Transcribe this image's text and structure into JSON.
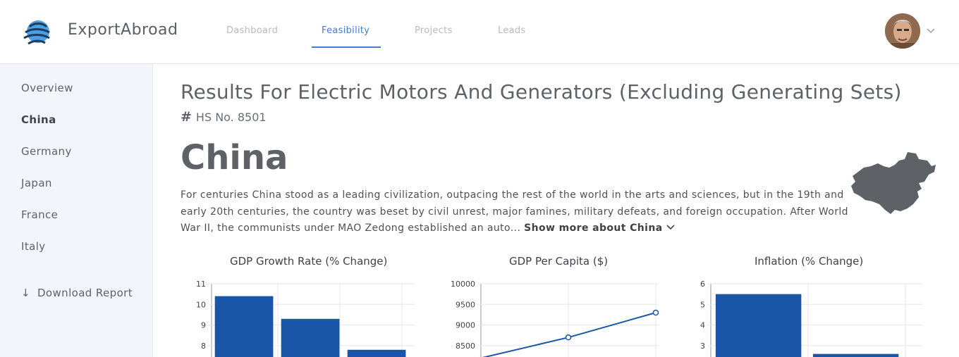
{
  "app": {
    "brand": "ExportAbroad"
  },
  "nav": {
    "tabs": [
      {
        "label": "Dashboard",
        "active": false
      },
      {
        "label": "Feasibility",
        "active": true
      },
      {
        "label": "Projects",
        "active": false
      },
      {
        "label": "Leads",
        "active": false
      }
    ],
    "accent_color": "#4a7cc4"
  },
  "user": {
    "avatar_icon": "user-avatar",
    "menu_icon": "chevron-down-icon"
  },
  "sidebar": {
    "items": [
      {
        "label": "Overview",
        "active": false
      },
      {
        "label": "China",
        "active": true
      },
      {
        "label": "Germany",
        "active": false
      },
      {
        "label": "Japan",
        "active": false
      },
      {
        "label": "France",
        "active": false
      },
      {
        "label": "Italy",
        "active": false
      }
    ],
    "download_label": "Download Report",
    "download_icon": "arrow-down-icon"
  },
  "main": {
    "title": "Results For Electric Motors And Generators (Excluding Generating Sets)",
    "hs_label": "HS No. 8501",
    "country": "China",
    "description": "For centuries China stood as a leading civilization, outpacing the rest of the world in the arts and sciences, but in the 19th and early 20th centuries, the country was beset by civil unrest, major famines, military defeats, and foreign occupation. After World War II, the communists under MAO Zedong established an auto...",
    "show_more": "Show more about China",
    "map_icon": "china-map-icon"
  },
  "chart_data": [
    {
      "type": "bar",
      "title": "GDP Growth Rate (% Change)",
      "categories": [
        "",
        "",
        ""
      ],
      "values": [
        10.4,
        9.3,
        7.8
      ],
      "yticks": [
        11,
        10,
        9,
        8
      ],
      "ylim": [
        7.5,
        11
      ],
      "color": "#1a56a8"
    },
    {
      "type": "line",
      "title": "GDP Per Capita ($)",
      "x": [
        0,
        1,
        2
      ],
      "values": [
        8200,
        8700,
        9300
      ],
      "yticks": [
        10000,
        9500,
        9000,
        8500
      ],
      "ylim": [
        8100,
        10000
      ],
      "color": "#1a56a8"
    },
    {
      "type": "bar",
      "title": "Inflation (% Change)",
      "categories": [
        "",
        ""
      ],
      "values": [
        5.5,
        2.6
      ],
      "yticks": [
        6,
        5,
        4,
        3
      ],
      "ylim": [
        2.5,
        6
      ],
      "color": "#1a56a8"
    }
  ]
}
